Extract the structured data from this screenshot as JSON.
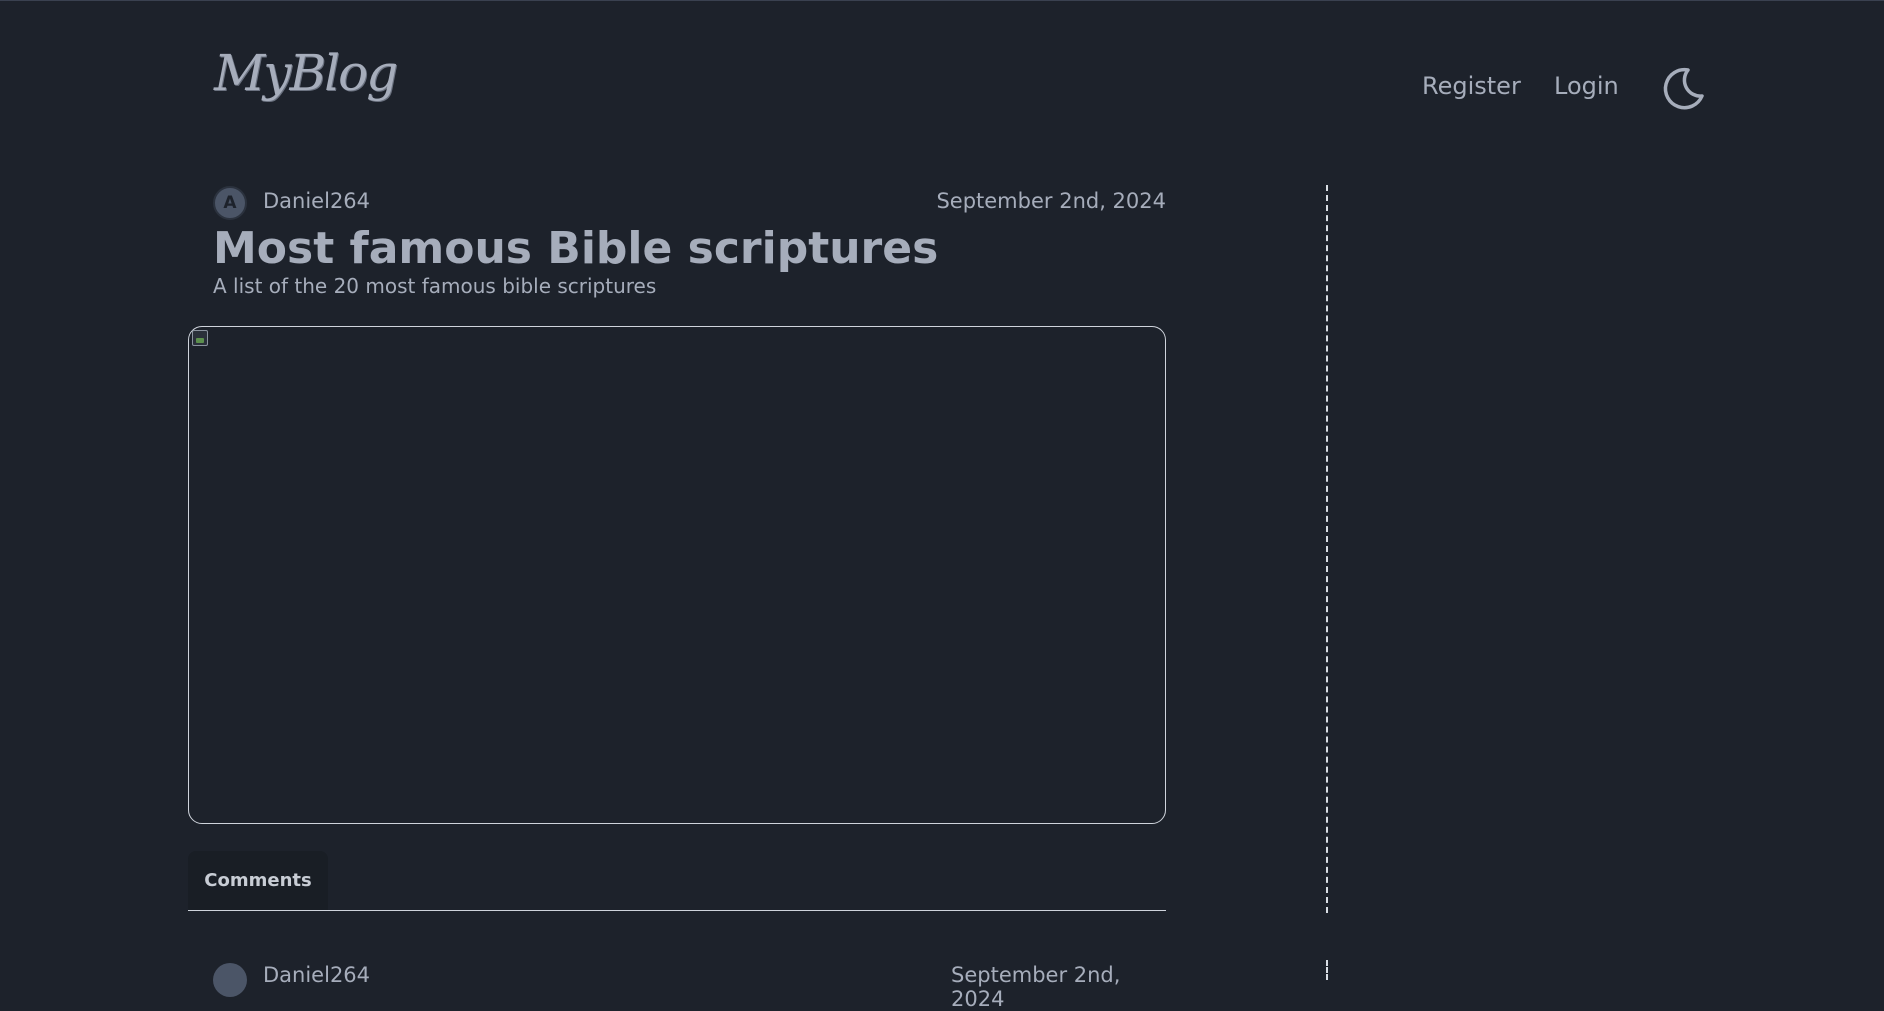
{
  "header": {
    "logo_text": "MyBlog",
    "nav": {
      "register": "Register",
      "login": "Login"
    },
    "theme_toggle_icon": "moon-icon"
  },
  "post": {
    "avatar_initial": "A",
    "author": "Daniel264",
    "date": "September 2nd, 2024",
    "title": "Most famous Bible scriptures",
    "subtitle": "A list of the 20 most famous bible scriptures",
    "image_icon": "broken-image-icon"
  },
  "comments": {
    "tab_label": "Comments",
    "first_comment": {
      "author": "Daniel264",
      "date": "September 2nd, 2024"
    }
  },
  "colors": {
    "background": "#1d222b",
    "text": "#a6adbb",
    "divider": "#d8dde4"
  }
}
